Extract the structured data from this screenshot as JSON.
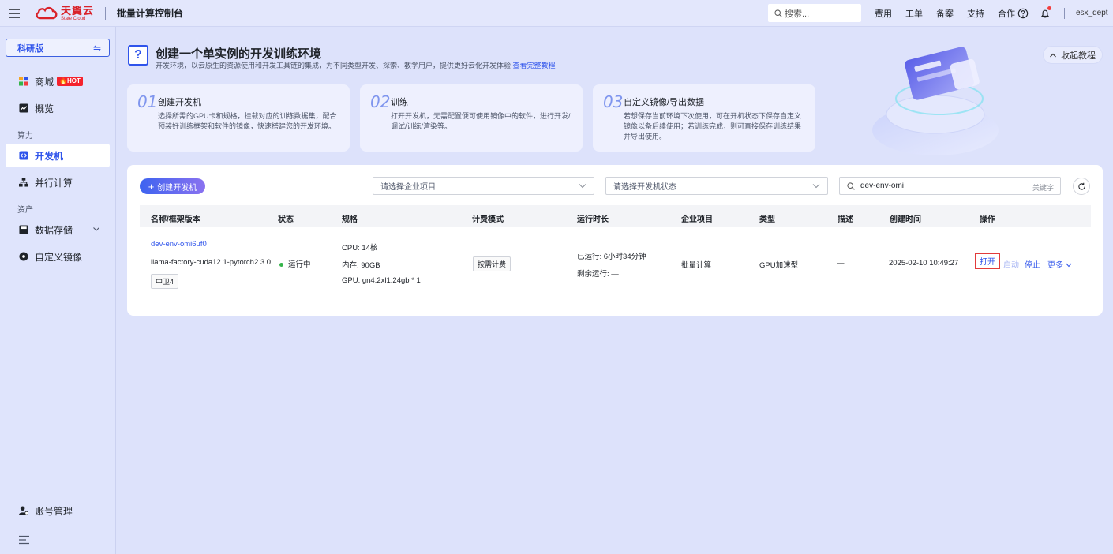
{
  "header": {
    "logo_cn": "天翼云",
    "logo_en": "State Cloud",
    "app_title": "批量计算控制台",
    "search_placeholder": "搜索...",
    "links": [
      "费用",
      "工单",
      "备案",
      "支持",
      "合作"
    ],
    "user": "esx_dept"
  },
  "sidebar": {
    "edition": "科研版",
    "items": [
      {
        "label": "商城",
        "badge": "HOT"
      },
      {
        "label": "概览"
      },
      {
        "label": "开发机"
      },
      {
        "label": "并行计算"
      },
      {
        "label": "数据存储"
      },
      {
        "label": "自定义镜像"
      }
    ],
    "sections": [
      "算力",
      "资产"
    ],
    "account": "账号管理"
  },
  "hero": {
    "title": "创建一个单实例的开发训练环境",
    "subtitle": "开发环境，以云原生的资源使用和开发工具链的集成，为不同类型开发、探索、教学用户，提供更好云化开发体验",
    "link": "查看完整教程",
    "collapse": "收起教程",
    "steps": [
      {
        "num": "01",
        "title": "创建开发机",
        "desc": "选择所需的GPU卡和规格，挂载对应的训练数据集，配合预装好训练框架和软件的镜像，快速搭建您的开发环境。"
      },
      {
        "num": "02",
        "title": "训练",
        "desc": "打开开发机，无需配置便可使用镜像中的软件，进行开发/调试/训练/渲染等。"
      },
      {
        "num": "03",
        "title": "自定义镜像/导出数据",
        "desc": "若想保存当前环境下次使用，可在开机状态下保存自定义镜像以备后续使用；若训练完成，则可直接保存训练结果并导出使用。"
      }
    ]
  },
  "toolbar": {
    "create_label": "创建开发机",
    "project_placeholder": "请选择企业项目",
    "status_placeholder": "请选择开发机状态",
    "search_value": "dev-env-omi",
    "search_hint": "关键字"
  },
  "table": {
    "headers": [
      "名称/框架版本",
      "状态",
      "规格",
      "计费模式",
      "运行时长",
      "企业项目",
      "类型",
      "描述",
      "创建时间",
      "操作"
    ],
    "rows": [
      {
        "name": "dev-env-omi6uf0",
        "framework": "llama-factory-cuda12.1-pytorch2.3.0",
        "region": "中卫4",
        "status": "运行中",
        "spec_cpu": "CPU: 14核",
        "spec_mem": "内存: 90GB",
        "spec_gpu": "GPU: gn4.2xl1.24gb * 1",
        "billing": "按需计费",
        "run_time": "已运行: 6小时34分钟",
        "remain": "剩余运行: —",
        "project": "批量计算",
        "type": "GPU加速型",
        "desc": "—",
        "created": "2025-02-10 10:49:27",
        "ops": {
          "open": "打开",
          "start": "启动",
          "stop": "停止",
          "more": "更多"
        }
      }
    ]
  },
  "colors": {
    "accent": "#2f54eb",
    "highlight": "#e23b3b",
    "running": "#35b44a"
  }
}
